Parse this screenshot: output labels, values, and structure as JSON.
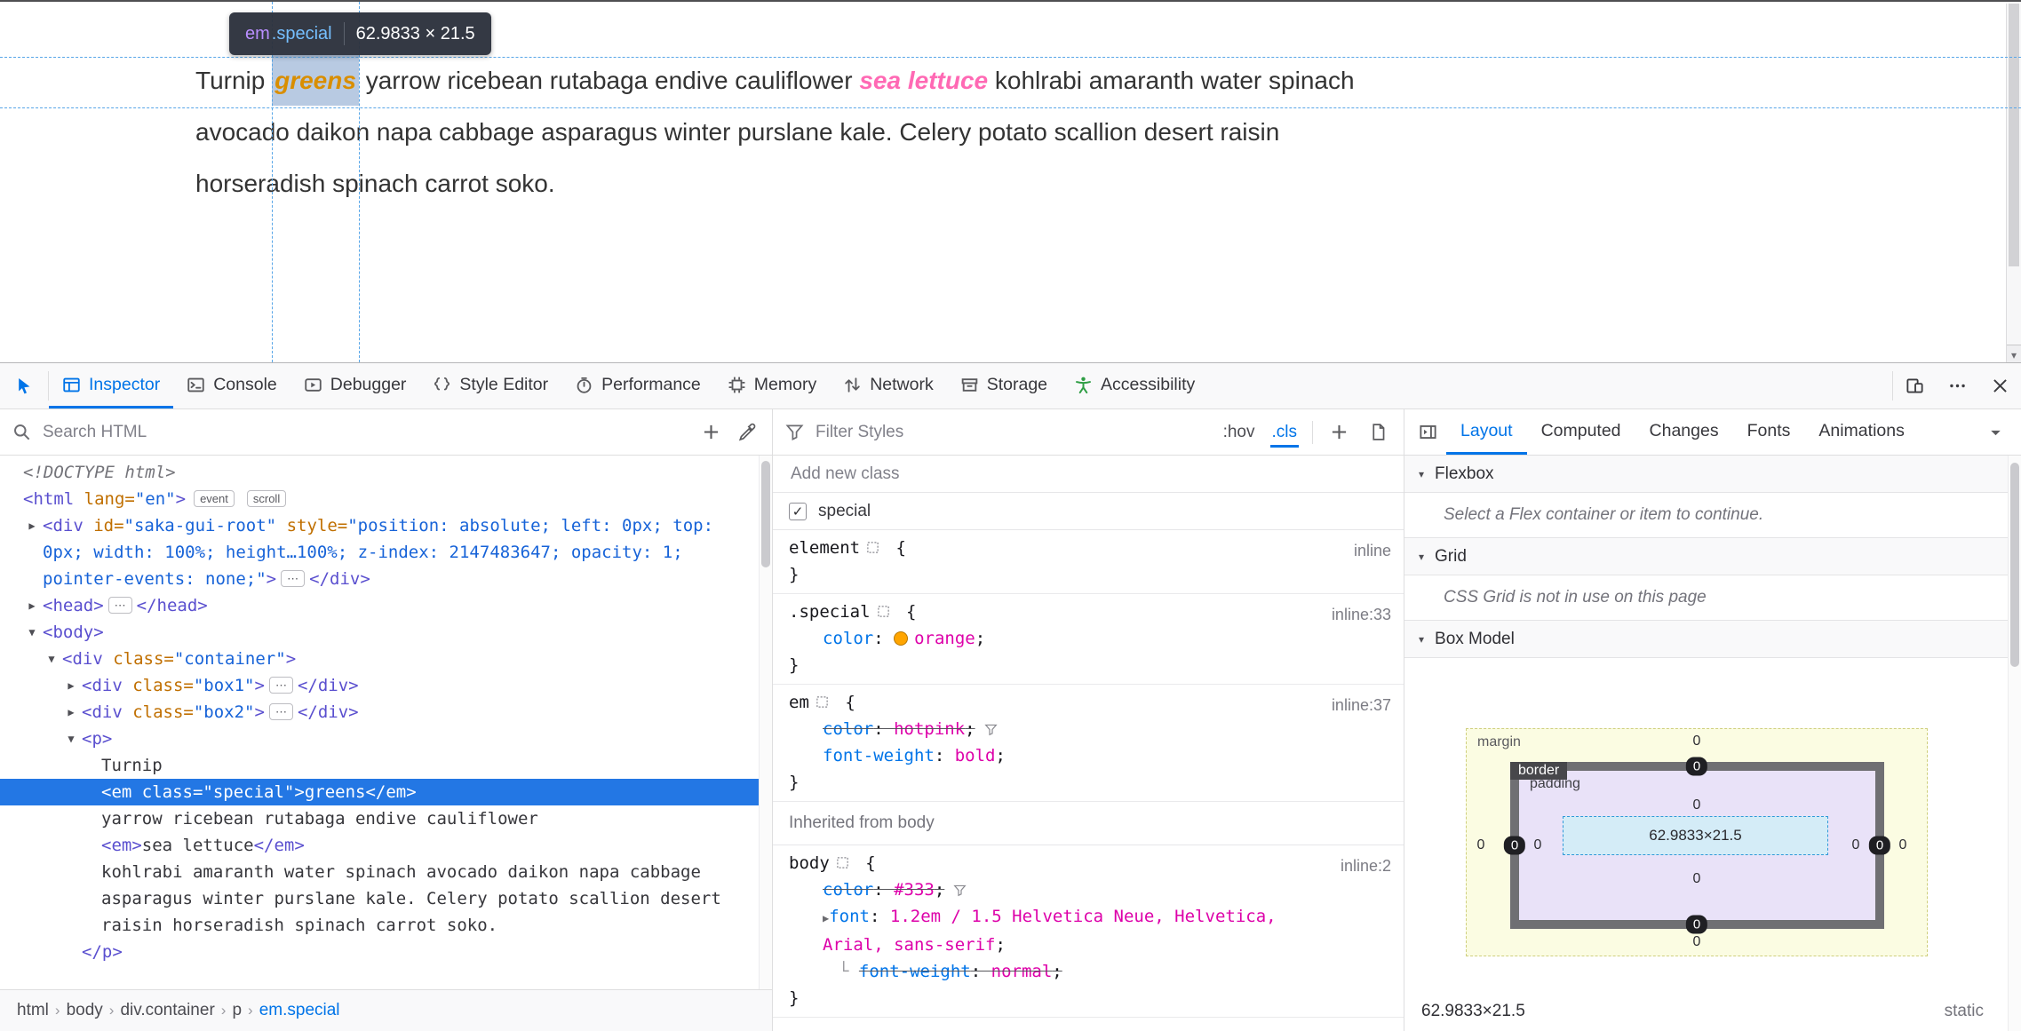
{
  "colors": {
    "accent_blue": "#0074e8",
    "selection_blue": "#2377e4",
    "css_value_magenta": "#dd00a9",
    "swatch_orange": "#ffa500",
    "hotpink": "#ff69b4",
    "accessibility_green": "#2f9e44"
  },
  "page": {
    "tooltip": {
      "tag": "em",
      "cls": ".special",
      "dims": "62.9833 × 21.5"
    },
    "paragraph_lines": [
      {
        "segments": [
          {
            "t": "Turnip ",
            "s": "plain"
          },
          {
            "t": "greens",
            "s": "selected"
          },
          {
            "t": " yarrow ricebean rutabaga endive cauliflower ",
            "s": "plain"
          },
          {
            "t": "sea lettuce",
            "s": "em"
          },
          {
            "t": " kohlrabi amaranth water spinach",
            "s": "plain"
          }
        ]
      },
      {
        "segments": [
          {
            "t": "avocado daikon napa cabbage asparagus winter purslane kale. Celery potato scallion desert raisin",
            "s": "plain"
          }
        ]
      },
      {
        "segments": [
          {
            "t": "horseradish spinach carrot soko.",
            "s": "plain"
          }
        ]
      }
    ]
  },
  "toolbar": {
    "tabs": [
      {
        "label": "Inspector",
        "icon": "inspector",
        "active": true
      },
      {
        "label": "Console",
        "icon": "console"
      },
      {
        "label": "Debugger",
        "icon": "debugger"
      },
      {
        "label": "Style Editor",
        "icon": "style-editor"
      },
      {
        "label": "Performance",
        "icon": "performance"
      },
      {
        "label": "Memory",
        "icon": "memory"
      },
      {
        "label": "Network",
        "icon": "network"
      },
      {
        "label": "Storage",
        "icon": "storage"
      },
      {
        "label": "Accessibility",
        "icon": "accessibility",
        "accent": "#2f9e44"
      }
    ],
    "right_icons": [
      "responsive-design",
      "menu",
      "close"
    ]
  },
  "markup": {
    "search_placeholder": "Search HTML",
    "tree": [
      {
        "i": 0,
        "a": "n",
        "tok": [
          [
            "doctype",
            "<!DOCTYPE html>"
          ]
        ]
      },
      {
        "i": 0,
        "a": "n",
        "tok": [
          [
            "tag",
            "<html"
          ],
          [
            "attr",
            " lang="
          ],
          [
            "val",
            "\"en\""
          ],
          [
            "tag",
            ">"
          ]
        ],
        "badges": [
          "event",
          "scroll"
        ]
      },
      {
        "i": 1,
        "a": "c",
        "tok": [
          [
            "tag",
            "<div"
          ],
          [
            "attr",
            " id="
          ],
          [
            "val",
            "\"saka-gui-root\""
          ],
          [
            "attr",
            " style="
          ],
          [
            "val",
            "\"position: absolute; left: 0px; top: 0px; width: 100%; height…100%; z-index: 2147483647; opacity: 1; pointer-events: none;\""
          ],
          [
            "tag",
            ">"
          ],
          [
            "chip",
            "⋯"
          ],
          [
            "tag",
            "</div>"
          ]
        ]
      },
      {
        "i": 1,
        "a": "c",
        "tok": [
          [
            "tag",
            "<head>"
          ],
          [
            "chip",
            "⋯"
          ],
          [
            "tag",
            "</head>"
          ]
        ]
      },
      {
        "i": 1,
        "a": "e",
        "tok": [
          [
            "tag",
            "<body>"
          ]
        ]
      },
      {
        "i": 2,
        "a": "e",
        "tok": [
          [
            "tag",
            "<div"
          ],
          [
            "attr",
            " class="
          ],
          [
            "val",
            "\"container\""
          ],
          [
            "tag",
            ">"
          ]
        ]
      },
      {
        "i": 3,
        "a": "c",
        "tok": [
          [
            "tag",
            "<div"
          ],
          [
            "attr",
            " class="
          ],
          [
            "val",
            "\"box1\""
          ],
          [
            "tag",
            ">"
          ],
          [
            "chip",
            "⋯"
          ],
          [
            "tag",
            "</div>"
          ]
        ]
      },
      {
        "i": 3,
        "a": "c",
        "tok": [
          [
            "tag",
            "<div"
          ],
          [
            "attr",
            " class="
          ],
          [
            "val",
            "\"box2\""
          ],
          [
            "tag",
            ">"
          ],
          [
            "chip",
            "⋯"
          ],
          [
            "tag",
            "</div>"
          ]
        ]
      },
      {
        "i": 3,
        "a": "e",
        "tok": [
          [
            "tag",
            "<p>"
          ]
        ]
      },
      {
        "i": 4,
        "a": "n",
        "tok": [
          [
            "txt",
            "Turnip"
          ]
        ]
      },
      {
        "i": 4,
        "a": "n",
        "sel": true,
        "tok": [
          [
            "tag",
            "<em"
          ],
          [
            "attr",
            " class="
          ],
          [
            "val",
            "\"special\""
          ],
          [
            "tag",
            ">"
          ],
          [
            "txt",
            "greens"
          ],
          [
            "tag",
            "</em>"
          ]
        ]
      },
      {
        "i": 4,
        "a": "n",
        "tok": [
          [
            "txt",
            "yarrow ricebean rutabaga endive cauliflower"
          ]
        ]
      },
      {
        "i": 4,
        "a": "n",
        "tok": [
          [
            "tag",
            "<em>"
          ],
          [
            "txt",
            "sea lettuce"
          ],
          [
            "tag",
            "</em>"
          ]
        ]
      },
      {
        "i": 4,
        "a": "n",
        "tok": [
          [
            "txt",
            "kohlrabi amaranth water spinach avocado daikon napa cabbage asparagus winter purslane kale. Celery potato scallion desert raisin horseradish spinach carrot soko."
          ]
        ]
      },
      {
        "i": 3,
        "a": "n",
        "tok": [
          [
            "tag",
            "</p>"
          ]
        ]
      }
    ],
    "breadcrumbs": [
      {
        "label": "html"
      },
      {
        "label": "body"
      },
      {
        "label": "div.container"
      },
      {
        "label": "p"
      },
      {
        "label": "em.special",
        "selected": true
      }
    ]
  },
  "rules": {
    "filter_placeholder": "Filter Styles",
    "toggles": {
      "hov": ":hov",
      "cls": ".cls"
    },
    "add_class_placeholder": "Add new class",
    "class_toggles": [
      {
        "name": "special",
        "checked": true
      }
    ],
    "sections": [
      {
        "type": "rule",
        "selector": "element",
        "location": "inline",
        "decls": []
      },
      {
        "type": "rule",
        "selector": ".special",
        "location": "inline:33",
        "decls": [
          {
            "prop": "color",
            "value": "orange",
            "swatch": "#ffa500"
          }
        ]
      },
      {
        "type": "rule",
        "selector": "em",
        "location": "inline:37",
        "decls": [
          {
            "prop": "color",
            "value": "hotpink",
            "overridden": true,
            "filter_icon": true
          },
          {
            "prop": "font-weight",
            "value": "bold"
          }
        ]
      },
      {
        "type": "header",
        "label": "Inherited from body"
      },
      {
        "type": "rule",
        "selector": "body",
        "location": "inline:2",
        "decls": [
          {
            "prop": "color",
            "value": "#333",
            "overridden": true,
            "filter_icon": true
          },
          {
            "prop": "font",
            "value": "1.2em / 1.5 Helvetica Neue, Helvetica, Arial, sans-serif",
            "expandable": true
          },
          {
            "prop": "font-weight",
            "value": "normal",
            "overridden": true,
            "computed_child": true
          }
        ]
      }
    ]
  },
  "layout_pane": {
    "tabs": [
      {
        "label": "Layout",
        "active": true
      },
      {
        "label": "Computed"
      },
      {
        "label": "Changes"
      },
      {
        "label": "Fonts"
      },
      {
        "label": "Animations"
      }
    ],
    "flexbox": {
      "title": "Flexbox",
      "message": "Select a Flex container or item to continue."
    },
    "grid": {
      "title": "Grid",
      "message": "CSS Grid is not in use on this page"
    },
    "box_model": {
      "title": "Box Model",
      "margin_label": "margin",
      "border_label": "border",
      "padding_label": "padding",
      "margin": {
        "top": "0",
        "right": "0",
        "bottom": "0",
        "left": "0"
      },
      "border": {
        "top": "0",
        "right": "0",
        "bottom": "0",
        "left": "0"
      },
      "padding": {
        "top": "0",
        "right": "0",
        "bottom": "0",
        "left": "0"
      },
      "content": "62.9833×21.5",
      "footer_size": "62.9833×21.5",
      "footer_position": "static"
    }
  }
}
